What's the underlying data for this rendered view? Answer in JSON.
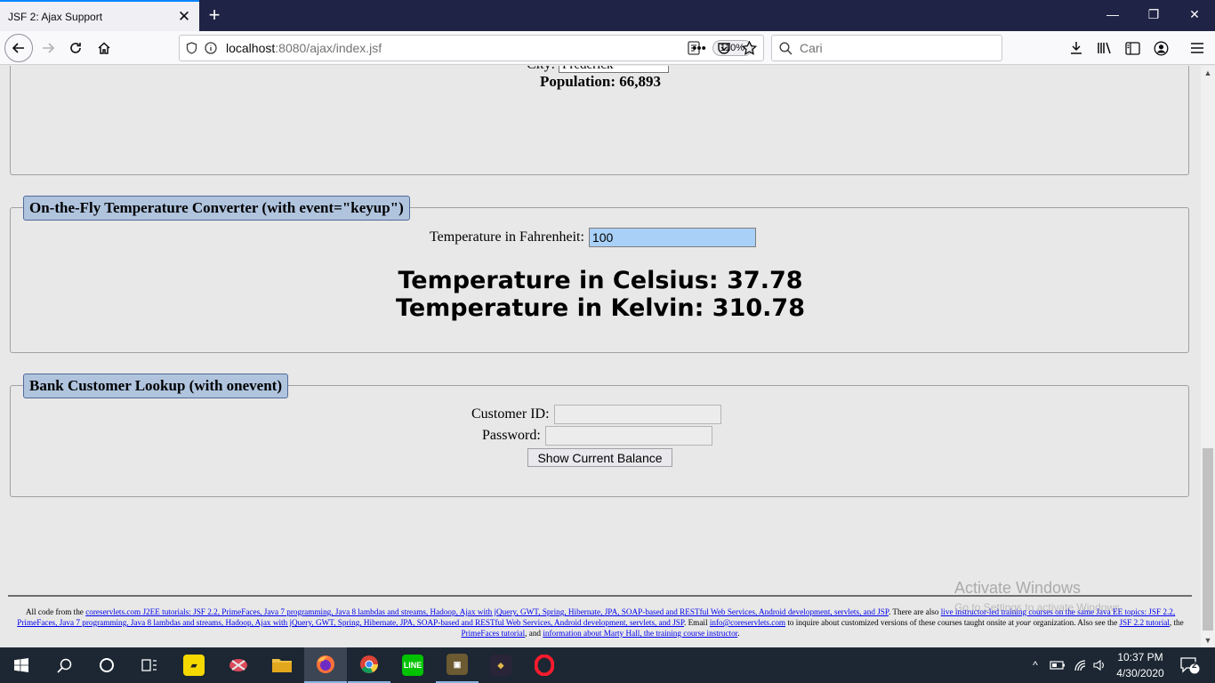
{
  "browser": {
    "tab_title": "JSF 2: Ajax Support",
    "tab_close": "✕",
    "new_tab": "+",
    "url_host": "localhost",
    "url_path": ":8080/ajax/index.jsf",
    "zoom": "110%",
    "search_placeholder": "Cari",
    "window_buttons": {
      "minimize": "—",
      "restore": "❐",
      "close": "✕"
    }
  },
  "population_section": {
    "city_label": "City:",
    "city_value": "Frederick",
    "population_text": "Population: 66,893"
  },
  "temperature_section": {
    "legend": "On-the-Fly Temperature Converter (with event=\"keyup\")",
    "fahrenheit_label": "Temperature in Fahrenheit:",
    "fahrenheit_value": "100",
    "celsius_text": "Temperature in Celsius: 37.78",
    "kelvin_text": "Temperature in Kelvin: 310.78"
  },
  "bank_section": {
    "legend": "Bank Customer Lookup (with onevent)",
    "customer_id_label": "Customer ID:",
    "customer_id_value": "",
    "password_label": "Password:",
    "password_value": "",
    "button_label": "Show Current Balance"
  },
  "footer": {
    "p1": "All code from the ",
    "l1": "coreservlets.com J2EE tutorials: JSF 2.2, PrimeFaces, Java 7 programming, Java 8 lambdas and streams, Hadoop, Ajax with jQuery, GWT, Spring, Hibernate, JPA, SOAP-based and RESTful Web Services, Android development, servlets, and JSP",
    "p2": ". There are also ",
    "l2": "live instructor-led training courses on the same Java EE topics: JSF 2.2, PrimeFaces, Java 7 programming, Java 8 lambdas and streams, Hadoop, Ajax with jQuery, GWT, Spring, Hibernate, JPA, SOAP-based and RESTful Web Services, Android development, servlets, and JSP",
    "p3": ". Email ",
    "l3": "info@coreservlets.com",
    "p4": " to inquire about customized versions of these courses taught onsite at ",
    "em": "your",
    "p5": " organization. Also see the ",
    "l4": "JSF 2.2 tutorial",
    "p6": ", the ",
    "l5": "PrimeFaces tutorial",
    "p7": ", and ",
    "l6": "information about Marty Hall, the training course instructor",
    "p8": "."
  },
  "watermark": {
    "title": "Activate Windows",
    "subtitle": "Go to Settings to activate Windows."
  },
  "taskbar": {
    "time": "10:37 PM",
    "date": "4/30/2020",
    "notification_count": "2"
  },
  "colors": {
    "legend_bg": "#b0c4de",
    "focused_input": "#a9d1f8",
    "link": "#0000ee",
    "taskbar": "#1c2733",
    "titlebar": "#1f2345"
  }
}
